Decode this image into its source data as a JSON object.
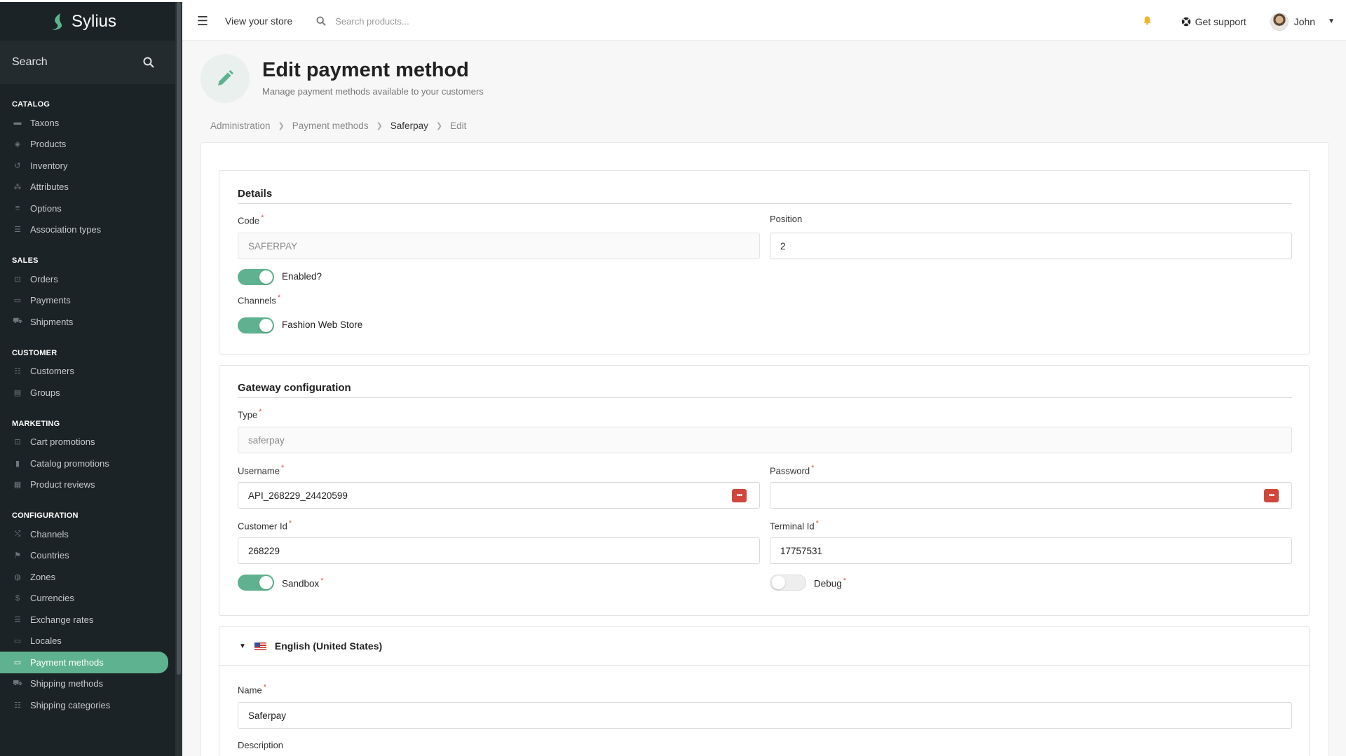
{
  "brand": {
    "name": "Sylius"
  },
  "sidebar": {
    "search_label": "Search",
    "sections": [
      {
        "heading": "CATALOG",
        "items": [
          {
            "label": "Taxons",
            "icon": "folder-icon"
          },
          {
            "label": "Products",
            "icon": "cube-icon"
          },
          {
            "label": "Inventory",
            "icon": "history-icon"
          },
          {
            "label": "Attributes",
            "icon": "cubes-icon"
          },
          {
            "label": "Options",
            "icon": "options-icon"
          },
          {
            "label": "Association types",
            "icon": "tasks-icon"
          }
        ]
      },
      {
        "heading": "SALES",
        "items": [
          {
            "label": "Orders",
            "icon": "cart-icon"
          },
          {
            "label": "Payments",
            "icon": "payment-icon"
          },
          {
            "label": "Shipments",
            "icon": "truck-icon"
          }
        ]
      },
      {
        "heading": "CUSTOMER",
        "items": [
          {
            "label": "Customers",
            "icon": "users-icon"
          },
          {
            "label": "Groups",
            "icon": "archive-icon"
          }
        ]
      },
      {
        "heading": "MARKETING",
        "items": [
          {
            "label": "Cart promotions",
            "icon": "cart-icon"
          },
          {
            "label": "Catalog promotions",
            "icon": "bookmark-icon"
          },
          {
            "label": "Product reviews",
            "icon": "newspaper-icon"
          }
        ]
      },
      {
        "heading": "CONFIGURATION",
        "items": [
          {
            "label": "Channels",
            "icon": "random-icon"
          },
          {
            "label": "Countries",
            "icon": "flag-icon"
          },
          {
            "label": "Zones",
            "icon": "globe-icon"
          },
          {
            "label": "Currencies",
            "icon": "dollar-icon"
          },
          {
            "label": "Exchange rates",
            "icon": "sliders-icon"
          },
          {
            "label": "Locales",
            "icon": "translate-icon"
          },
          {
            "label": "Payment methods",
            "icon": "payment-icon",
            "active": true
          },
          {
            "label": "Shipping methods",
            "icon": "truck-icon"
          },
          {
            "label": "Shipping categories",
            "icon": "list-icon"
          }
        ]
      }
    ]
  },
  "topbar": {
    "view_store": "View your store",
    "search_placeholder": "Search products...",
    "support": "Get support",
    "user": "John"
  },
  "header": {
    "title": "Edit payment method",
    "subtitle": "Manage payment methods available to your customers"
  },
  "breadcrumb": [
    "Administration",
    "Payment methods",
    "Saferpay",
    "Edit"
  ],
  "details": {
    "title": "Details",
    "code_label": "Code",
    "code_value": "SAFERPAY",
    "position_label": "Position",
    "position_value": "2",
    "enabled_label": "Enabled?",
    "channels_label": "Channels",
    "channel_name": "Fashion Web Store"
  },
  "gateway": {
    "title": "Gateway configuration",
    "type_label": "Type",
    "type_value": "saferpay",
    "username_label": "Username",
    "username_value": "API_268229_24420599",
    "password_label": "Password",
    "password_value": "",
    "customer_id_label": "Customer Id",
    "customer_id_value": "268229",
    "terminal_id_label": "Terminal Id",
    "terminal_id_value": "17757531",
    "sandbox_label": "Sandbox",
    "debug_label": "Debug"
  },
  "translation": {
    "locale": "English (United States)",
    "name_label": "Name",
    "name_value": "Saferpay",
    "description_label": "Description"
  },
  "colors": {
    "accent": "#5fb28f",
    "sidebar_bg": "#1c2326",
    "required": "#d9534f"
  }
}
